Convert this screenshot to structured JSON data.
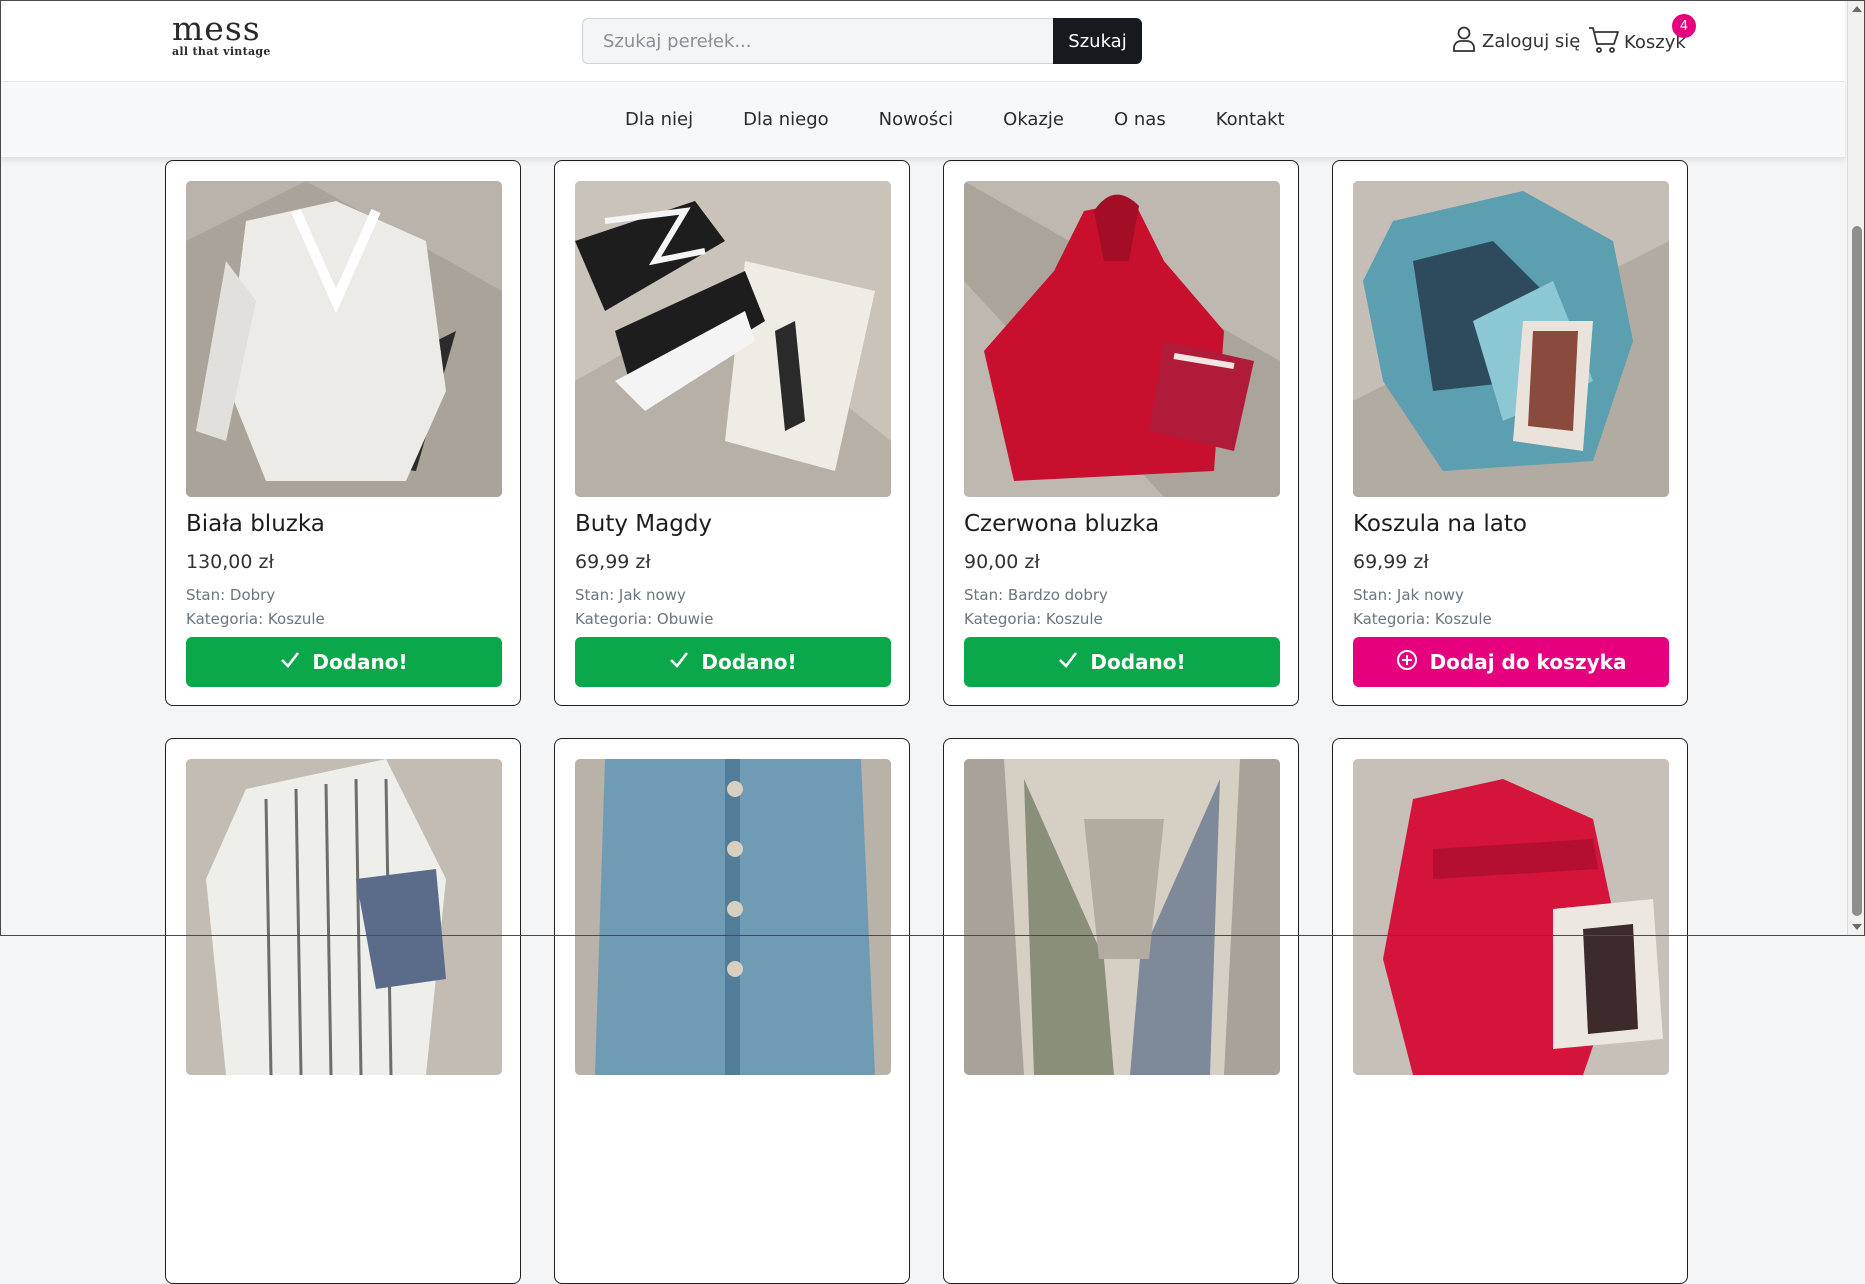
{
  "header": {
    "logo_main": "mess",
    "logo_sub": "all that vintage",
    "search_placeholder": "Szukaj perełek...",
    "search_button": "Szukaj",
    "login_label": "Zaloguj się",
    "cart_label": "Koszyk",
    "cart_count": "4"
  },
  "nav": {
    "items": [
      "Dla niej",
      "Dla niego",
      "Nowości",
      "Okazje",
      "O nas",
      "Kontakt"
    ]
  },
  "products": [
    {
      "title": "Biała bluzka",
      "price": "130,00 zł",
      "state": "Stan: Dobry",
      "category": "Kategoria: Koszule",
      "button": "Dodano!",
      "added": true
    },
    {
      "title": "Buty Magdy",
      "price": "69,99 zł",
      "state": "Stan: Jak nowy",
      "category": "Kategoria: Obuwie",
      "button": "Dodano!",
      "added": true
    },
    {
      "title": "Czerwona bluzka",
      "price": "90,00 zł",
      "state": "Stan: Bardzo dobry",
      "category": "Kategoria: Koszule",
      "button": "Dodano!",
      "added": true
    },
    {
      "title": "Koszula na lato",
      "price": "69,99 zł",
      "state": "Stan: Jak nowy",
      "category": "Kategoria: Koszule",
      "button": "Dodaj do koszyka",
      "added": false
    }
  ],
  "colors": {
    "added": "#0aa84a",
    "add": "#e6007e",
    "search_button": "#16191d"
  }
}
